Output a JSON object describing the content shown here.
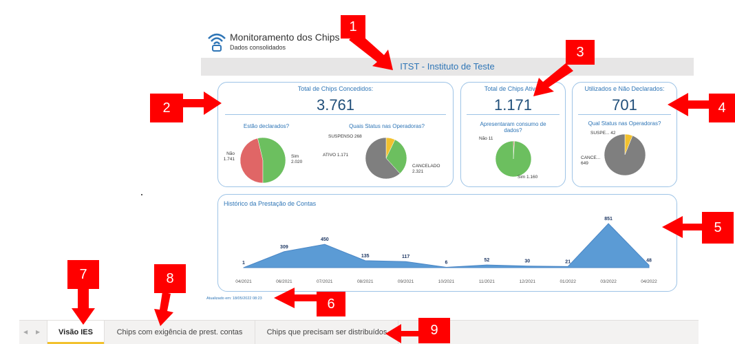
{
  "header": {
    "app_title": "Monitoramento dos Chips",
    "app_subtitle": "Dados consolidados",
    "institution": "ITST - Instituto de Teste"
  },
  "kpi_concedidos": {
    "title": "Total de Chips Concedidos:",
    "value": "3.761",
    "pie1_title": "Estão declarados?",
    "pie1_label_nao": "Não\n1.741",
    "pie1_label_sim": "Sim\n2.020",
    "pie2_title": "Quais Status nas Operadoras?",
    "pie2_label_suspenso": "SUSPENSO 268",
    "pie2_label_ativo": "ATIVO 1.171",
    "pie2_label_cancelado": "CANCELADO\n2.321"
  },
  "kpi_ativos": {
    "title": "Total de Chips Ativos",
    "value": "1.171",
    "pie_title": "Apresentaram consumo de dados?",
    "label_nao": "Não 11",
    "label_sim": "Sim 1.160"
  },
  "kpi_nao_declarados": {
    "title": "Utilizados e Não Declarados:",
    "value": "701",
    "pie_title": "Qual Status nas Operadoras?",
    "label_suspe": "SUSPE... 42",
    "label_cance": "CANCE...\n649"
  },
  "history": {
    "title": "Histórico da Prestação de Contas"
  },
  "updated_text": "Atualizado em: 18/05/2022 08:23",
  "tabs": [
    {
      "label": "Visão IES"
    },
    {
      "label": "Chips com exigência de prest. contas"
    },
    {
      "label": "Chips que precisam ser distribuídos"
    }
  ],
  "annotations": [
    "1",
    "2",
    "3",
    "4",
    "5",
    "6",
    "7",
    "8",
    "9"
  ],
  "colors": {
    "accent": "#2e75b6",
    "area": "#5b9bd5",
    "green": "#6cbf5f",
    "red": "#e06666",
    "gray": "#7f7f7f",
    "yellow": "#f2c12e",
    "annotation": "#ff0000"
  },
  "chart_data": [
    {
      "type": "pie",
      "title": "Estão declarados?",
      "categories": [
        "Não",
        "Sim"
      ],
      "values": [
        1741,
        2020
      ],
      "colors": [
        "#e06666",
        "#6cbf5f"
      ]
    },
    {
      "type": "pie",
      "title": "Quais Status nas Operadoras?",
      "categories": [
        "SUSPENSO",
        "ATIVO",
        "CANCELADO"
      ],
      "values": [
        268,
        1171,
        2321
      ],
      "colors": [
        "#f2c12e",
        "#6cbf5f",
        "#7f7f7f"
      ]
    },
    {
      "type": "pie",
      "title": "Apresentaram consumo de dados?",
      "categories": [
        "Não",
        "Sim"
      ],
      "values": [
        11,
        1160
      ],
      "colors": [
        "#e06666",
        "#6cbf5f"
      ]
    },
    {
      "type": "pie",
      "title": "Qual Status nas Operadoras?",
      "categories": [
        "SUSPE...",
        "CANCE..."
      ],
      "values": [
        42,
        649
      ],
      "colors": [
        "#f2c12e",
        "#7f7f7f"
      ]
    },
    {
      "type": "area",
      "title": "Histórico da Prestação de Contas",
      "categories": [
        "04/2021",
        "06/2021",
        "07/2021",
        "08/2021",
        "09/2021",
        "10/2021",
        "11/2021",
        "12/2021",
        "01/2022",
        "03/2022",
        "04/2022"
      ],
      "values": [
        1,
        309,
        450,
        135,
        117,
        6,
        52,
        30,
        21,
        851,
        48
      ],
      "ylim": [
        0,
        900
      ]
    }
  ]
}
